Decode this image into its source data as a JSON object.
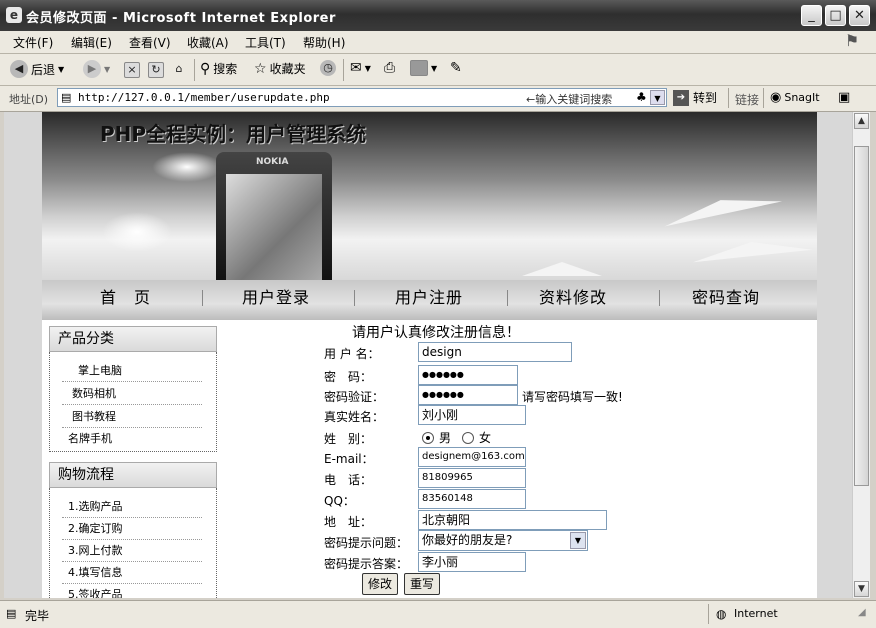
{
  "window": {
    "title": "会员修改页面 - Microsoft Internet Explorer"
  },
  "menu": [
    "文件(F)",
    "编辑(E)",
    "查看(V)",
    "收藏(A)",
    "工具(T)",
    "帮助(H)"
  ],
  "toolbar": {
    "back": "后退",
    "search": "搜索",
    "favorites": "收藏夹"
  },
  "address": {
    "label": "地址(D)",
    "url": "http://127.0.0.1/member/userupdate.php",
    "hint": "←输入关键词搜索",
    "go": "转到",
    "links": "链接",
    "snagit": "SnagIt"
  },
  "banner": {
    "title": "PHP全程实例：用户管理系统",
    "phone_brand": "NOKIA"
  },
  "nav": [
    "首　页",
    "用户登录",
    "用户注册",
    "资料修改",
    "密码查询"
  ],
  "sidebar": {
    "categories_title": "产品分类",
    "categories": [
      "掌上电脑",
      "数码相机",
      "图书教程",
      "名牌手机"
    ],
    "process_title": "购物流程",
    "process": [
      "1.选购产品",
      "2.确定订购",
      "3.网上付款",
      "4.填写信息",
      "5.签收产品"
    ]
  },
  "form": {
    "heading": "请用户认真修改注册信息！",
    "username_label": "用 户 名：",
    "username": "design",
    "password_label": "密　码：",
    "password": "●●●●●●",
    "confirm_label": "密码验证：",
    "confirm": "●●●●●●",
    "confirm_note": "请写密码填写一致!",
    "realname_label": "真实姓名：",
    "realname": "刘小刚",
    "gender_label": "姓　别：",
    "gender_male": "男",
    "gender_female": "女",
    "email_label": "E-mail：",
    "email": "designem@163.com",
    "phone_label": "电　话：",
    "phone": "81809965",
    "qq_label": "QQ：",
    "qq": "83560148",
    "address_label": "地　址：",
    "address": "北京朝阳",
    "question_label": "密码提示问题：",
    "question": "你最好的朋友是?",
    "answer_label": "密码提示答案：",
    "answer": "李小丽",
    "submit": "修改",
    "reset": "重写"
  },
  "status": {
    "text": "完毕",
    "zone": "Internet"
  }
}
